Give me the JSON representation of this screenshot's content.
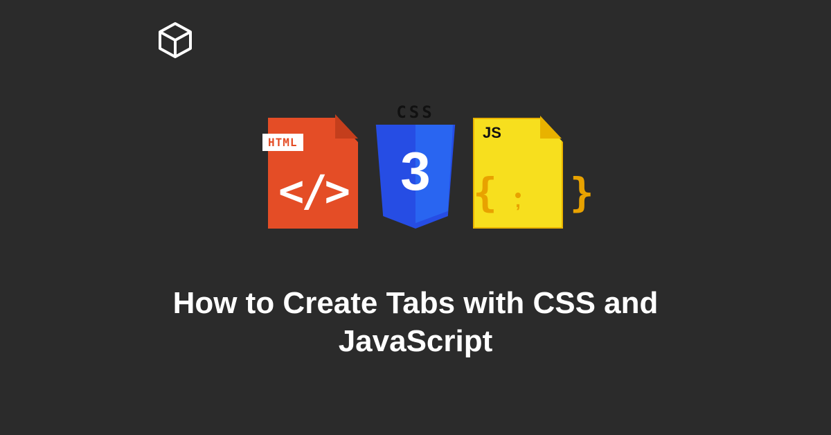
{
  "icons": {
    "html_label": "HTML",
    "html_brackets": "</>",
    "css_label": "CSS",
    "css_number": "3",
    "js_label": "JS",
    "js_braces_left": "{",
    "js_braces_right": "}"
  },
  "title": "How to Create Tabs with CSS and JavaScript",
  "colors": {
    "background": "#2b2b2b",
    "html": "#e44d26",
    "css": "#264de4",
    "js": "#f7df1e",
    "text": "#ffffff"
  }
}
